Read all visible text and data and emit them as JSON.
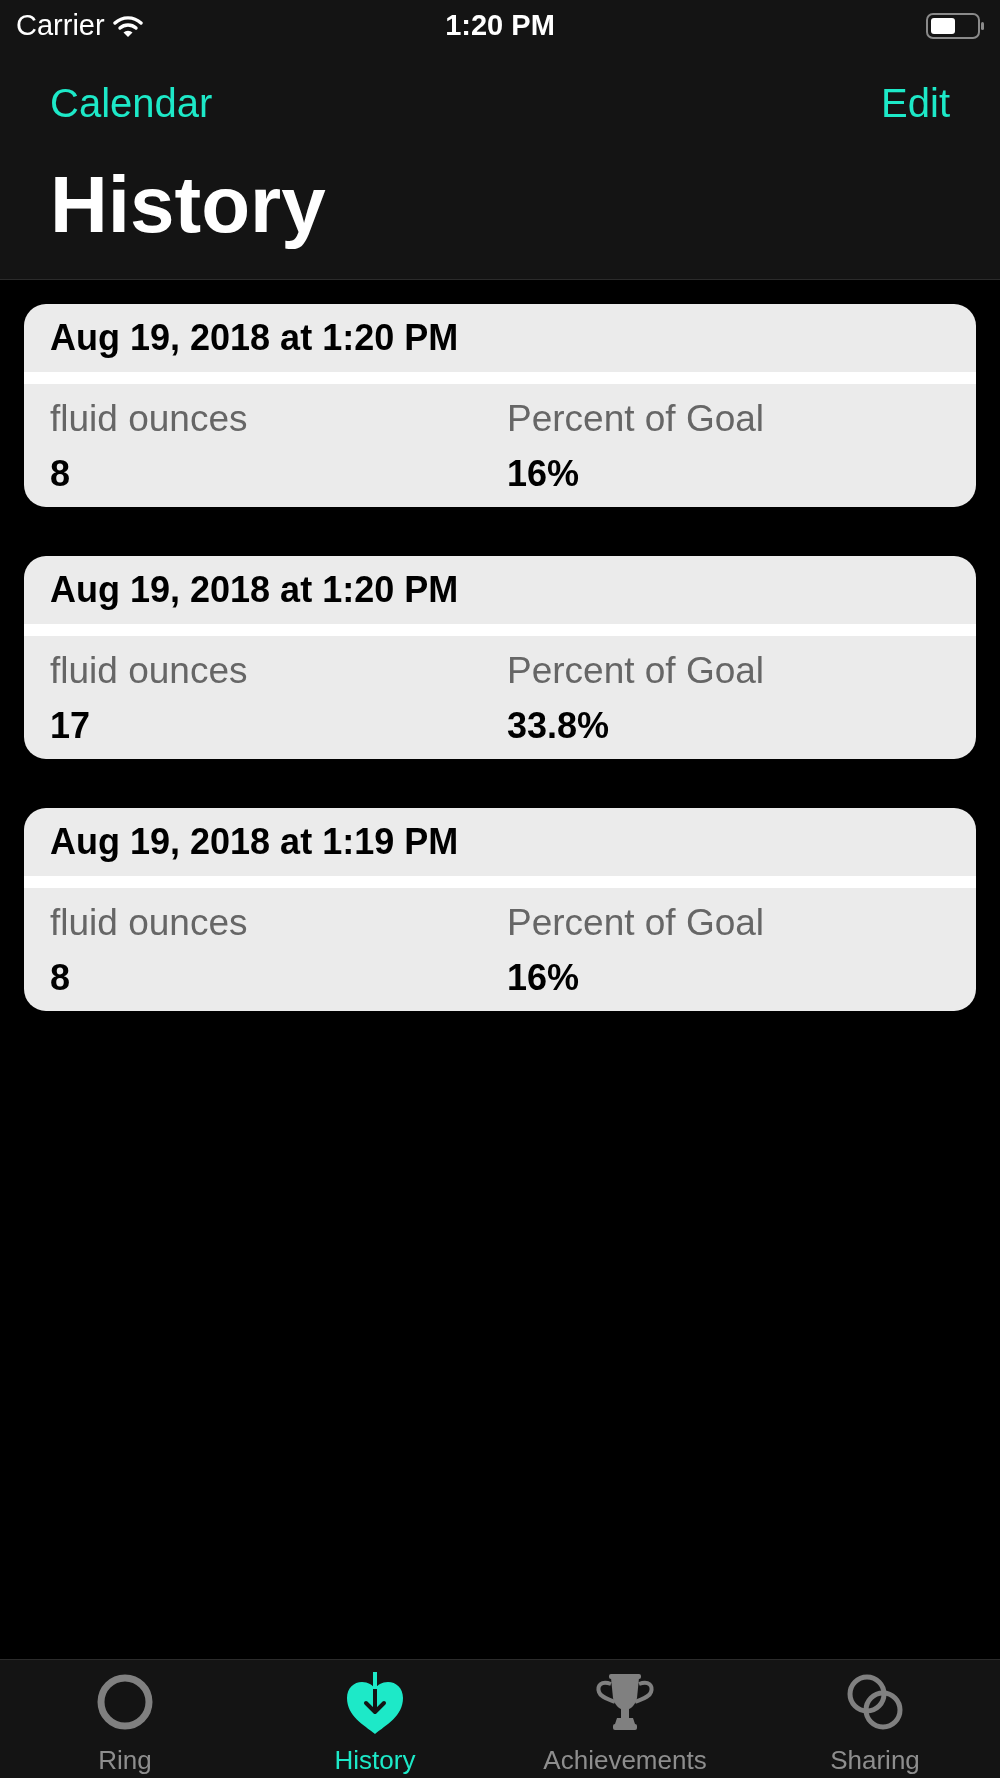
{
  "status_bar": {
    "carrier": "Carrier",
    "time": "1:20 PM"
  },
  "nav_bar": {
    "left_button": "Calendar",
    "right_button": "Edit",
    "title": "History"
  },
  "entries": [
    {
      "date": "Aug 19, 2018 at 1:20 PM",
      "fields": [
        {
          "label": "fluid ounces",
          "value": "8"
        },
        {
          "label": "Percent of Goal",
          "value": "16%"
        }
      ]
    },
    {
      "date": "Aug 19, 2018 at 1:20 PM",
      "fields": [
        {
          "label": "fluid ounces",
          "value": "17"
        },
        {
          "label": "Percent of Goal",
          "value": "33.8%"
        }
      ]
    },
    {
      "date": "Aug 19, 2018 at 1:19 PM",
      "fields": [
        {
          "label": "fluid ounces",
          "value": "8"
        },
        {
          "label": "Percent of Goal",
          "value": "16%"
        }
      ]
    }
  ],
  "tab_bar": {
    "items": [
      {
        "label": "Ring",
        "kind": "ring",
        "selected": false
      },
      {
        "label": "History",
        "kind": "heart",
        "selected": true
      },
      {
        "label": "Achievements",
        "kind": "trophy",
        "selected": false
      },
      {
        "label": "Sharing",
        "kind": "rings",
        "selected": false
      }
    ]
  }
}
